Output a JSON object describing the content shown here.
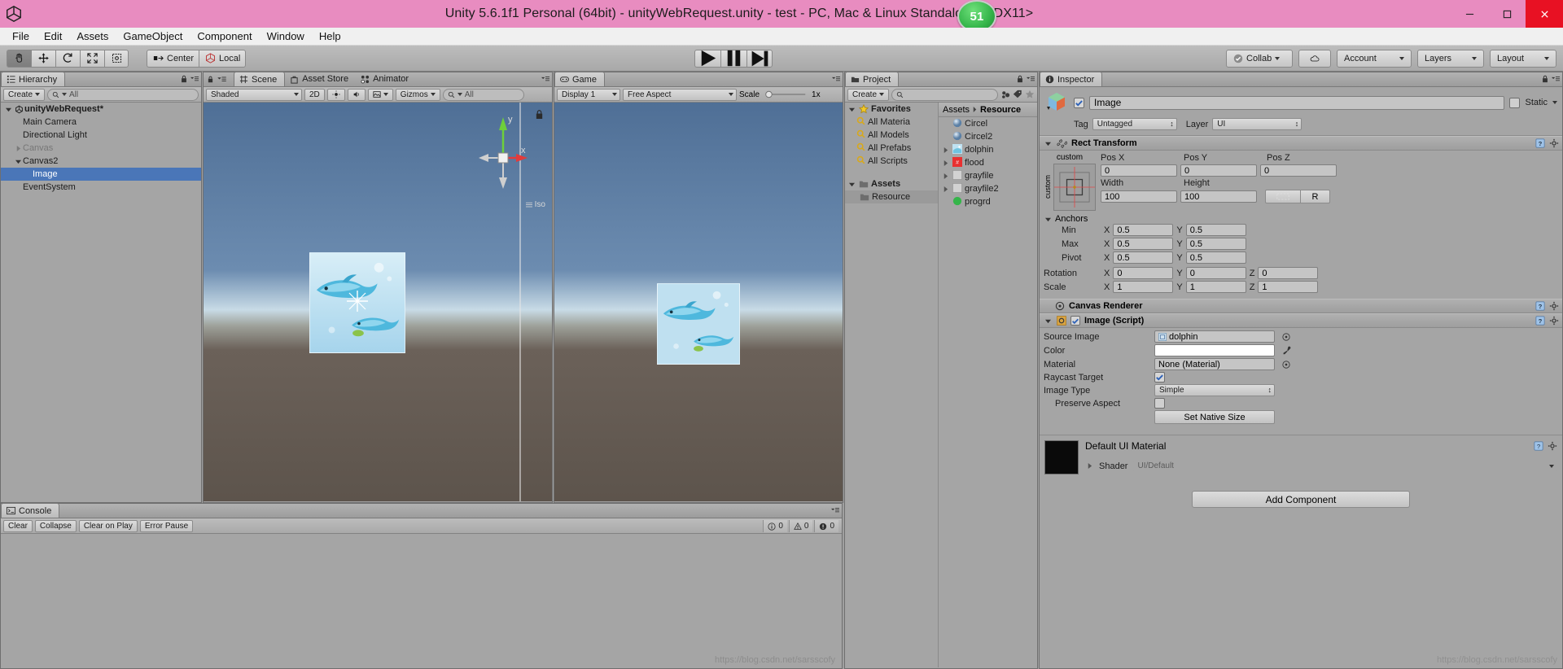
{
  "window": {
    "title": "Unity 5.6.1f1 Personal (64bit) - unityWebRequest.unity - test - PC, Mac & Linux Standalone* <DX11>",
    "badge": "51",
    "minimize": "–",
    "maximize": "❐",
    "close": "✕"
  },
  "menu": [
    "File",
    "Edit",
    "Assets",
    "GameObject",
    "Component",
    "Window",
    "Help"
  ],
  "toolbar": {
    "tools": [
      "hand-tool",
      "move-tool",
      "rotate-tool",
      "scale-tool",
      "rect-tool"
    ],
    "pivot_mode": "Center",
    "pivot_rotation": "Local",
    "play": "▶",
    "pause": "❙❙",
    "step": "▶|",
    "collab": "Collab",
    "cloud": "cloud-icon",
    "account": "Account",
    "layers": "Layers",
    "layout": "Layout"
  },
  "hierarchy": {
    "tab": "Hierarchy",
    "create": "Create",
    "search_placeholder": "All",
    "items": [
      {
        "label": "unityWebRequest*",
        "depth": 0,
        "arrow": "down",
        "icon": "unity-icon",
        "bold": true,
        "selected": false,
        "dim": false
      },
      {
        "label": "Main Camera",
        "depth": 1,
        "arrow": "none",
        "icon": "none",
        "bold": false,
        "selected": false,
        "dim": false
      },
      {
        "label": "Directional Light",
        "depth": 1,
        "arrow": "none",
        "icon": "none",
        "bold": false,
        "selected": false,
        "dim": false
      },
      {
        "label": "Canvas",
        "depth": 1,
        "arrow": "right",
        "icon": "none",
        "bold": false,
        "selected": false,
        "dim": true
      },
      {
        "label": "Canvas2",
        "depth": 1,
        "arrow": "down",
        "icon": "none",
        "bold": false,
        "selected": false,
        "dim": false
      },
      {
        "label": "Image",
        "depth": 2,
        "arrow": "none",
        "icon": "none",
        "bold": false,
        "selected": true,
        "dim": false
      },
      {
        "label": "EventSystem",
        "depth": 1,
        "arrow": "none",
        "icon": "none",
        "bold": false,
        "selected": false,
        "dim": false
      }
    ]
  },
  "scene": {
    "tabs": [
      {
        "label": "Scene",
        "icon": "scene-icon",
        "active": true
      },
      {
        "label": "Asset Store",
        "icon": "store-icon",
        "active": false
      },
      {
        "label": "Animator",
        "icon": "animator-icon",
        "active": false
      }
    ],
    "draw_mode": "Shaded",
    "mode_2d": "2D",
    "gizmos": "Gizmos",
    "search_placeholder": "All",
    "axis_x": "x",
    "axis_y": "y",
    "projection": "Iso"
  },
  "game": {
    "tab": "Game",
    "display": "Display 1",
    "aspect": "Free Aspect",
    "scale_label": "Scale",
    "scale_value": "1x"
  },
  "project": {
    "tab": "Project",
    "create": "Create",
    "search_placeholder": "",
    "favorites_label": "Favorites",
    "favorites": [
      "All Materia",
      "All Models",
      "All Prefabs",
      "All Scripts"
    ],
    "assets_label": "Assets",
    "resource_label": "Resource",
    "breadcrumb": [
      "Assets",
      "Resource"
    ],
    "files": [
      {
        "name": "Circel",
        "icon": "sphere",
        "expandable": false
      },
      {
        "name": "Circel2",
        "icon": "sphere",
        "expandable": false
      },
      {
        "name": "dolphin",
        "icon": "texture",
        "expandable": true
      },
      {
        "name": "flood",
        "icon": "red",
        "expandable": true
      },
      {
        "name": "grayfile",
        "icon": "blank",
        "expandable": true
      },
      {
        "name": "grayfile2",
        "icon": "blank",
        "expandable": true
      },
      {
        "name": "progrd",
        "icon": "green",
        "expandable": false
      }
    ]
  },
  "inspector": {
    "tab": "Inspector",
    "object_name": "Image",
    "object_enabled": true,
    "static_label": "Static",
    "static_checked": false,
    "tag_label": "Tag",
    "tag_value": "Untagged",
    "layer_label": "Layer",
    "layer_value": "UI",
    "rect_transform": {
      "title": "Rect Transform",
      "anchor_preset": "custom",
      "anchor_preset_side": "custom",
      "pos_x_label": "Pos X",
      "pos_x": "0",
      "pos_y_label": "Pos Y",
      "pos_y": "0",
      "pos_z_label": "Pos Z",
      "pos_z": "0",
      "width_label": "Width",
      "width": "100",
      "height_label": "Height",
      "height": "100",
      "blueprint_label": "R",
      "anchors_label": "Anchors",
      "min_label": "Min",
      "min_x": "0.5",
      "min_y": "0.5",
      "max_label": "Max",
      "max_x": "0.5",
      "max_y": "0.5",
      "pivot_label": "Pivot",
      "pivot_x": "0.5",
      "pivot_y": "0.5",
      "rotation_label": "Rotation",
      "rot_x": "0",
      "rot_y": "0",
      "rot_z": "0",
      "scale_label": "Scale",
      "scale_x": "1",
      "scale_y": "1",
      "scale_z": "1",
      "x_label": "X",
      "y_label": "Y",
      "z_label": "Z"
    },
    "canvas_renderer": {
      "title": "Canvas Renderer"
    },
    "image_script": {
      "title": "Image (Script)",
      "enabled": true,
      "source_image_label": "Source Image",
      "source_image": "dolphin",
      "color_label": "Color",
      "color_value": "#FFFFFF",
      "material_label": "Material",
      "material_value": "None (Material)",
      "raycast_label": "Raycast Target",
      "raycast_checked": true,
      "image_type_label": "Image Type",
      "image_type_value": "Simple",
      "preserve_aspect_label": "Preserve Aspect",
      "preserve_aspect_checked": false,
      "set_native_size": "Set Native Size"
    },
    "material_block": {
      "title": "Default UI Material",
      "shader_label": "Shader",
      "shader_value": "UI/Default"
    },
    "add_component": "Add Component",
    "watermark": "https://blog.csdn.net/sarsscofy"
  },
  "console": {
    "tab": "Console",
    "clear": "Clear",
    "collapse": "Collapse",
    "clear_on_play": "Clear on Play",
    "error_pause": "Error Pause",
    "log_count": "0",
    "warn_count": "0",
    "error_count": "0"
  },
  "colors": {
    "titlebar": "#e88cc0",
    "selection": "#4a76b8",
    "panel": "#a5a5a5",
    "badge_green": "#35b54a",
    "close_red": "#e81123"
  }
}
